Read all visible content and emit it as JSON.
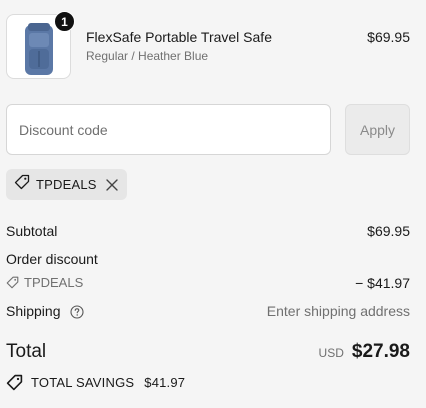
{
  "product": {
    "name": "FlexSafe Portable Travel Safe",
    "variant": "Regular / Heather Blue",
    "price": "$69.95",
    "quantity": "1",
    "image_color": "#5b78a6"
  },
  "discount": {
    "placeholder": "Discount code",
    "apply_label": "Apply",
    "applied_code": "TPDEALS"
  },
  "summary": {
    "subtotal_label": "Subtotal",
    "subtotal_value": "$69.95",
    "order_discount_label": "Order discount",
    "discount_code": "TPDEALS",
    "discount_value": "− $41.97",
    "shipping_label": "Shipping",
    "shipping_value": "Enter shipping address",
    "total_label": "Total",
    "currency": "USD",
    "total_value": "$27.98",
    "savings_label": "TOTAL SAVINGS",
    "savings_value": "$41.97"
  }
}
